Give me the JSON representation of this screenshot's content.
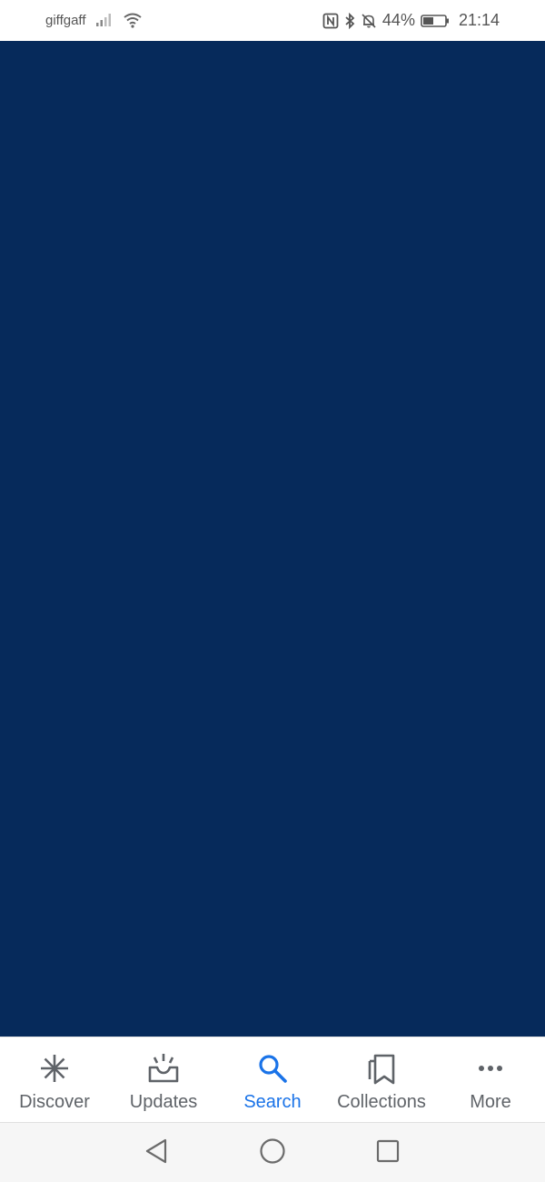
{
  "status_bar": {
    "carrier": "giffgaff",
    "battery_percent": "44%",
    "time": "21:14",
    "icons": [
      "signal-icon",
      "wifi-icon",
      "nfc-icon",
      "bluetooth-icon",
      "notifications-off-icon",
      "battery-icon"
    ]
  },
  "content": {
    "background_color": "#062a5b"
  },
  "bottom_nav": {
    "active_color": "#1a73e8",
    "inactive_color": "#5f6368",
    "items": [
      {
        "label": "Discover",
        "icon": "discover-icon",
        "active": false
      },
      {
        "label": "Updates",
        "icon": "updates-icon",
        "active": false
      },
      {
        "label": "Search",
        "icon": "search-icon",
        "active": true
      },
      {
        "label": "Collections",
        "icon": "collections-icon",
        "active": false
      },
      {
        "label": "More",
        "icon": "more-icon",
        "active": false
      }
    ]
  },
  "system_nav": {
    "buttons": [
      "back-icon",
      "home-icon",
      "recents-icon"
    ]
  }
}
